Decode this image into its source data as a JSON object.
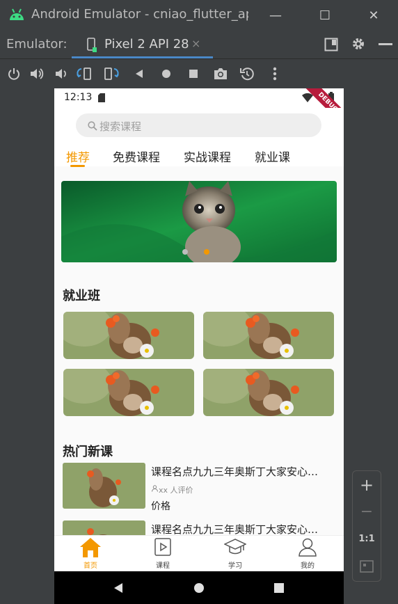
{
  "window": {
    "title": "Android Emulator - cniao_flutter_app",
    "controls": {
      "minimize": "—",
      "maximize": "☐",
      "close": "✕"
    }
  },
  "emulator_bar": {
    "label": "Emulator:",
    "device_tab": "Pixel 2 API 28",
    "close_tab": "×"
  },
  "toolbar": {
    "icons": [
      "power-icon",
      "volume-up-icon",
      "volume-down-icon",
      "rotate-left-icon",
      "rotate-right-icon",
      "back-icon",
      "home-icon",
      "overview-icon",
      "camera-icon",
      "replay-icon",
      "more-icon"
    ]
  },
  "statusbar": {
    "time": "12:13",
    "debug": "DEBUG"
  },
  "search": {
    "placeholder": "搜索课程"
  },
  "tabs": [
    {
      "label": "推荐",
      "active": true
    },
    {
      "label": "免费课程"
    },
    {
      "label": "实战课程"
    },
    {
      "label": "就业课"
    }
  ],
  "banner": {
    "dots": 2,
    "active_dot": 1,
    "accent": "#f39800"
  },
  "job_section": {
    "title": "就业班",
    "card_count": 4
  },
  "hot_section": {
    "title": "热门新课",
    "items": [
      {
        "title": "课程名点九九三年奥斯丁大家安心…",
        "meta": "xx 人评价",
        "price": "价格"
      },
      {
        "title": "课程名点九九三年奥斯丁大家安心…"
      }
    ]
  },
  "bottom_nav": [
    {
      "label": "首页",
      "icon": "home-icon",
      "active": true
    },
    {
      "label": "课程",
      "icon": "course-icon"
    },
    {
      "label": "学习",
      "icon": "study-icon"
    },
    {
      "label": "我的",
      "icon": "profile-icon"
    }
  ],
  "side_panel": {
    "zoom_in": "+",
    "zoom_out": "−",
    "one_to_one": "1:1"
  },
  "colors": {
    "accent": "#f39800",
    "chrome": "#3c3f41",
    "tab_underline": "#4a88c7"
  }
}
